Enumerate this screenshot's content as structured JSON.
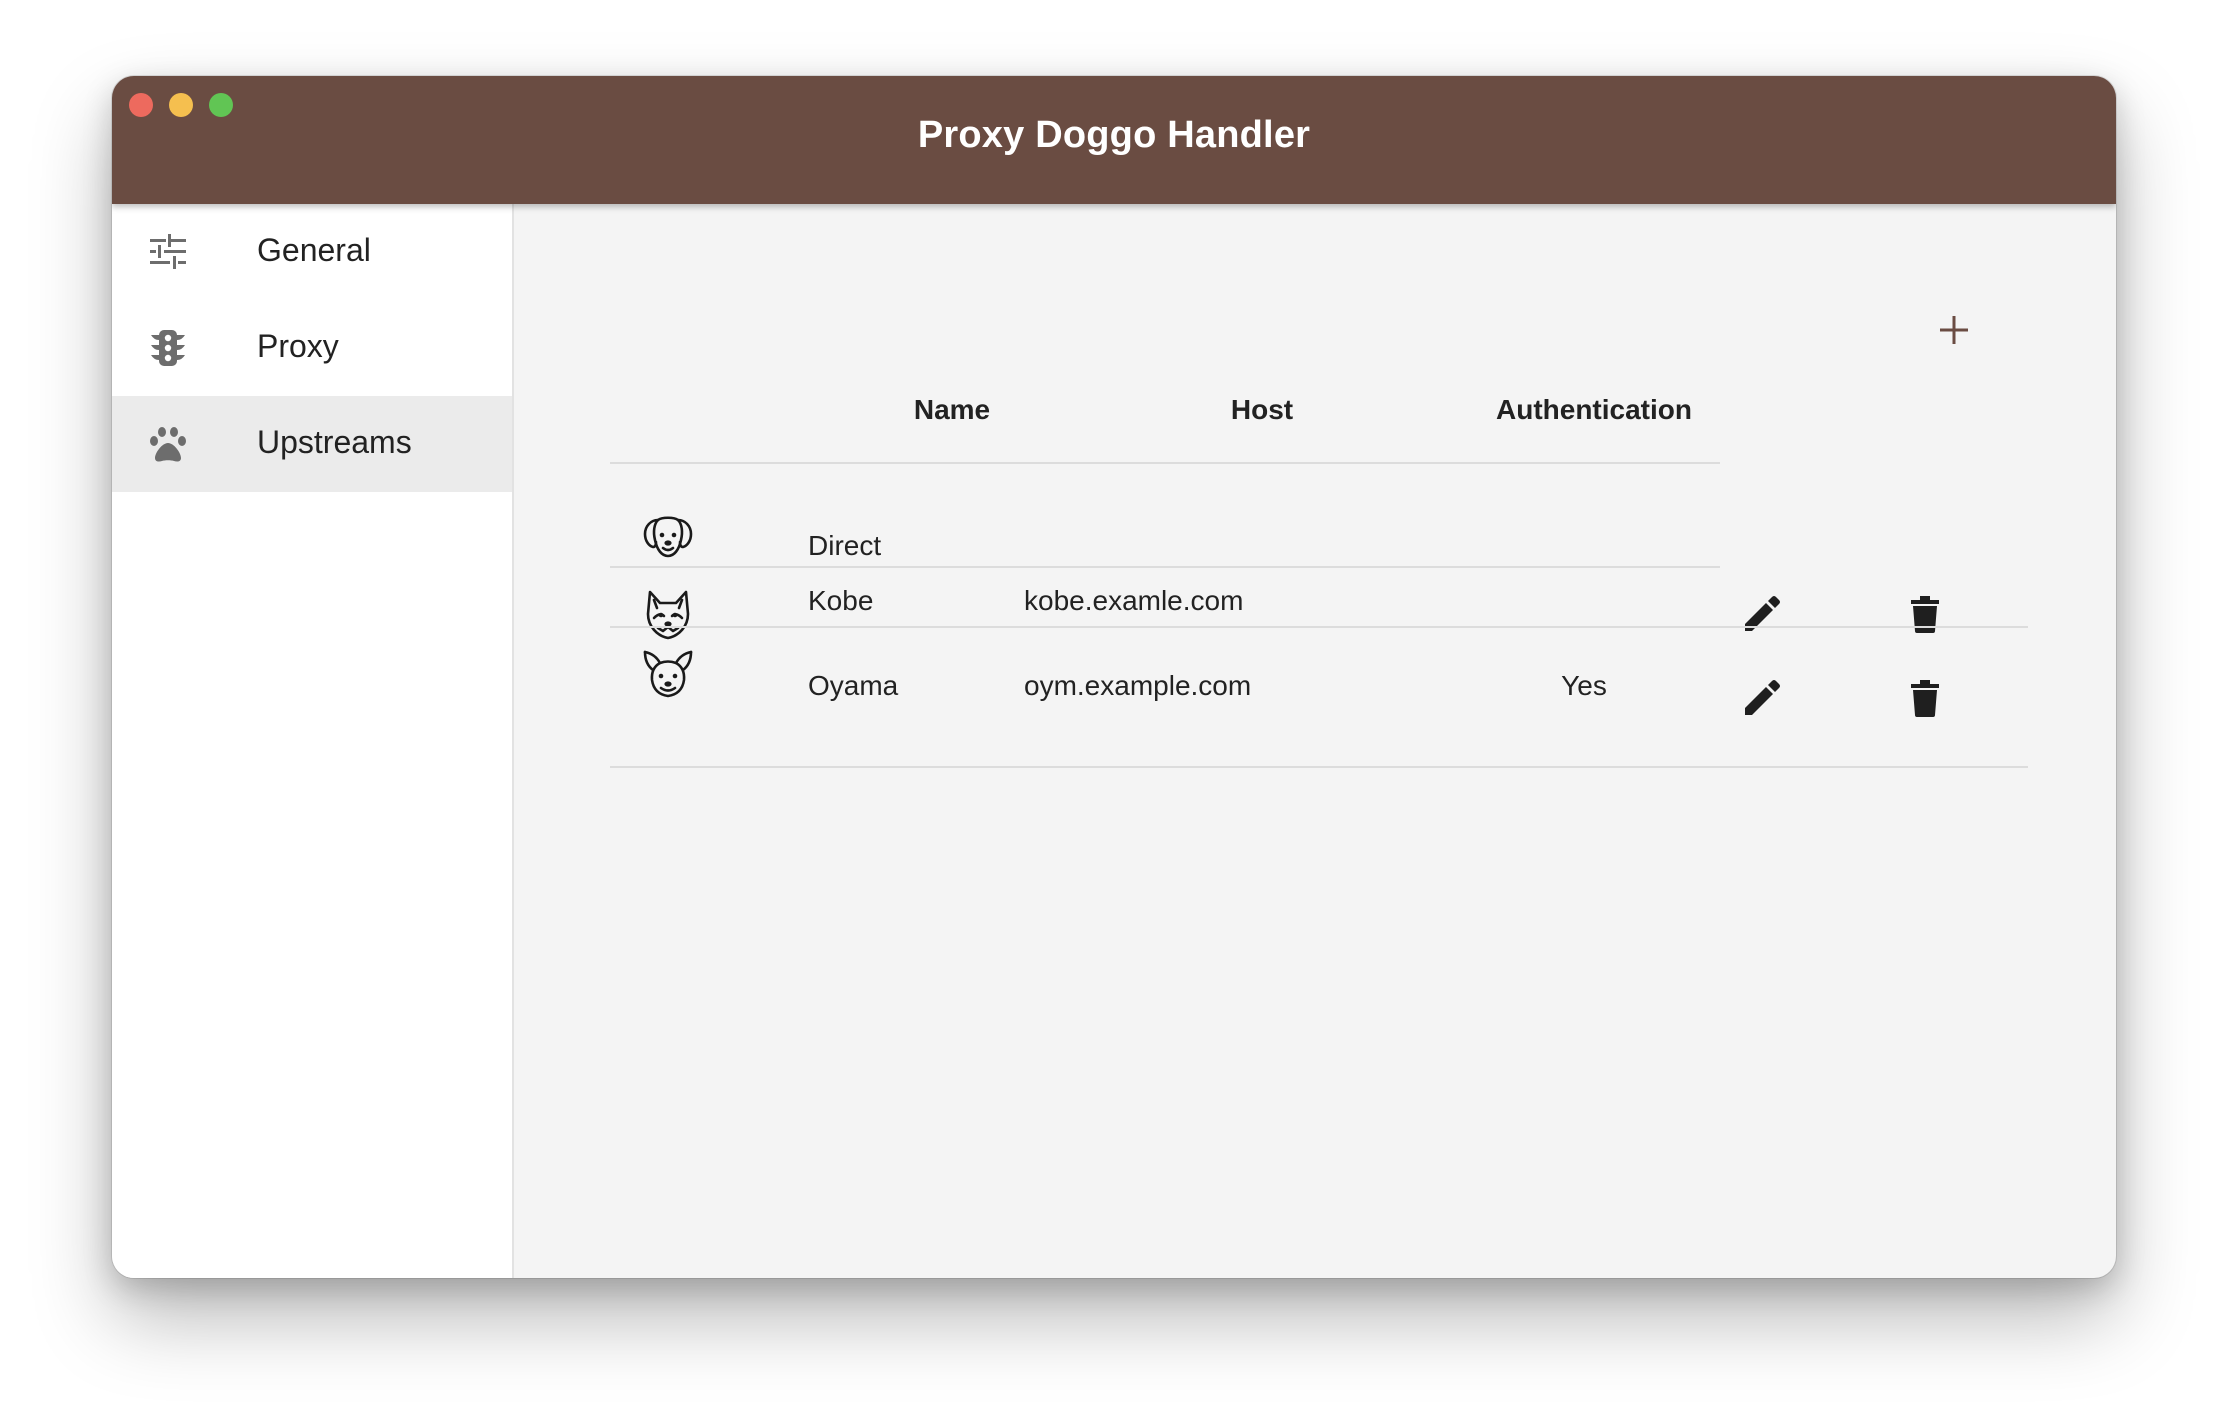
{
  "window": {
    "title": "Proxy Doggo Handler"
  },
  "colors": {
    "titlebar": "#6a4c42",
    "accent": "#6a4c42",
    "sidebar_active": "#ebebeb"
  },
  "sidebar": {
    "items": [
      {
        "label": "General",
        "icon": "tune-sliders-icon",
        "active": false
      },
      {
        "label": "Proxy",
        "icon": "traffic-light-icon",
        "active": false
      },
      {
        "label": "Upstreams",
        "icon": "paw-icon",
        "active": true
      }
    ]
  },
  "toolbar": {
    "add_icon": "plus-icon"
  },
  "table": {
    "columns": [
      "Name",
      "Host",
      "Authentication"
    ],
    "rows": [
      {
        "icon": "golden-retriever-face-icon",
        "name": "Direct",
        "host": "",
        "auth": "",
        "editable": false
      },
      {
        "icon": "husky-face-icon",
        "name": "Kobe",
        "host": "kobe.examle.com",
        "auth": "",
        "editable": true
      },
      {
        "icon": "corgi-face-icon",
        "name": "Oyama",
        "host": "oym.example.com",
        "auth": "Yes",
        "editable": true
      }
    ],
    "edit_icon": "pencil-icon",
    "delete_icon": "trash-icon"
  }
}
